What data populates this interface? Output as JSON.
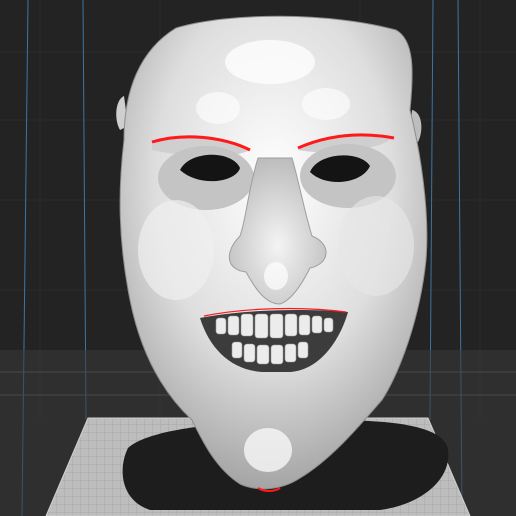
{
  "viewport": {
    "background_color": "#232323",
    "grid_line_color": "#2c2c2c",
    "build_volume_edge_color": "#3a6f9c",
    "build_plate_color": "#b9b9b9",
    "build_plate_grid_color": "#a9a9a9",
    "shadow_color": "#1e1e1e"
  },
  "model": {
    "surface_color": "#dcdcdc",
    "overhang_highlight_color": "#ff1a1a",
    "eye_hole_color": "#141414"
  }
}
